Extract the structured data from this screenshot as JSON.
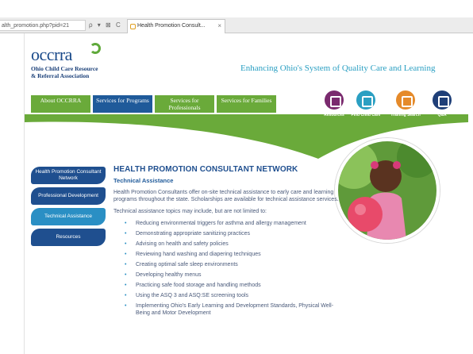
{
  "browser": {
    "url": "alth_promotion.php?pid=21",
    "nav_icons": "ρ ▾ ⊠ C",
    "tab_title": "Health Promotion Consult...",
    "tab_close": "×"
  },
  "header": {
    "logo": "occrra",
    "org_name": "Ohio Child Care Resource & Referral Association",
    "tagline": "Enhancing Ohio's System of Quality Care and Learning"
  },
  "topnav": [
    {
      "label": "About OCCRRA"
    },
    {
      "label": "Services for Programs"
    },
    {
      "label": "Services for Professionals"
    },
    {
      "label": "Services for Families"
    }
  ],
  "quicklinks": [
    {
      "label": "Resources",
      "icon": "folder-icon",
      "color": "#7a2a6e"
    },
    {
      "label": "Find Child Care",
      "icon": "search-icon",
      "color": "#2a9fc2"
    },
    {
      "label": "Training Search",
      "icon": "screen-icon",
      "color": "#e58a2a"
    },
    {
      "label": "Q&A",
      "icon": "star-icon",
      "color": "#1f3f78"
    }
  ],
  "sidenav": [
    {
      "label": "Health Promotion Consultant Network"
    },
    {
      "label": "Professional Development"
    },
    {
      "label": "Technical Assistance"
    },
    {
      "label": "Resources"
    }
  ],
  "content": {
    "heading": "HEALTH PROMOTION CONSULTANT NETWORK",
    "subheading": "Technical Assistance",
    "intro": "Health Promotion Consultants offer on-site technical assistance to early care and learning programs throughout the state. Scholarships are available for technical assistance services.",
    "topics_intro": "Technical assistance topics may include, but are not limited to:",
    "topics": [
      "Reducing environmental triggers for asthma and allergy management",
      "Demonstrating appropriate sanitizing practices",
      "Advising on health and safety policies",
      "Reviewing hand washing and diapering techniques",
      "Creating optimal safe sleep environments",
      "Developing healthy menus",
      "Practicing safe food storage and handling methods",
      "Using the ASQ 3 and ASQ:SE screening tools",
      "Implementing Ohio's Early Learning and Development Standards, Physical Well-Being and Motor Development"
    ]
  },
  "colors": {
    "brand_blue": "#1f4f8f",
    "brand_green": "#6aaa3a",
    "accent_teal": "#2a9fc2"
  }
}
